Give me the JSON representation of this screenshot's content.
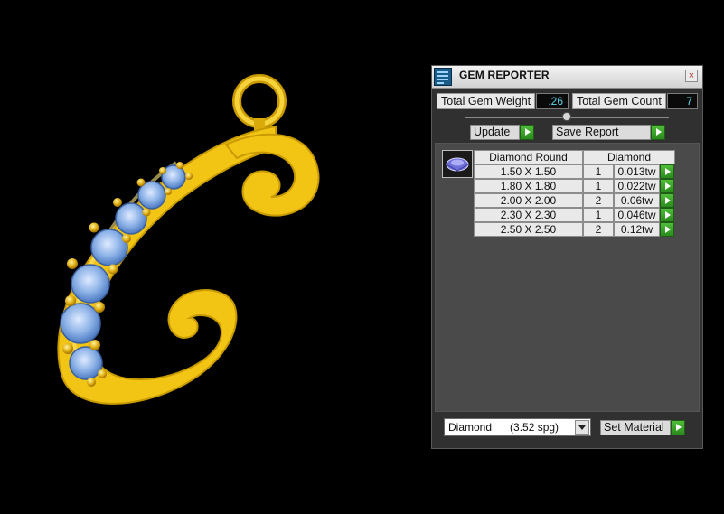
{
  "panel": {
    "title": "GEM REPORTER",
    "close_glyph": "×",
    "icon": "gem-reporter-app-icon"
  },
  "summary": {
    "weight_label": "Total Gem Weight",
    "weight_value": ".26",
    "count_label": "Total Gem Count",
    "count_value": "7"
  },
  "toolbar": {
    "update_label": "Update",
    "save_label": "Save Report"
  },
  "report": {
    "gem_icon": "round-diamond-icon",
    "header_shape": "Diamond Round",
    "header_material": "Diamond",
    "rows": [
      {
        "size": "1.50 X 1.50",
        "count": "1",
        "weight": "0.013tw"
      },
      {
        "size": "1.80 X 1.80",
        "count": "1",
        "weight": "0.022tw"
      },
      {
        "size": "2.00 X 2.00",
        "count": "2",
        "weight": "0.06tw"
      },
      {
        "size": "2.30 X 2.30",
        "count": "1",
        "weight": "0.046tw"
      },
      {
        "size": "2.50 X 2.50",
        "count": "2",
        "weight": "0.12tw"
      }
    ]
  },
  "material": {
    "selected": "Diamond      (3.52 spg)",
    "set_label": "Set Material"
  },
  "colors": {
    "gold": "#f2c413",
    "gem_blue": "#8fb4e8",
    "accent_green": "#3aa52a",
    "value_cyan": "#5fd7e8"
  }
}
